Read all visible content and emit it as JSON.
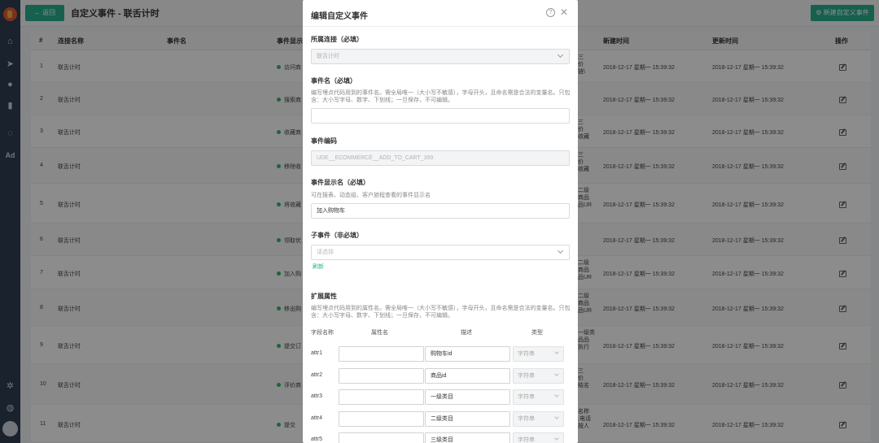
{
  "header": {
    "back_label": "← 返回",
    "title": "自定义事件 - 联舌计时",
    "new_label": "⚙ 新建自定义事件"
  },
  "table": {
    "columns": [
      "#",
      "连接名称",
      "事件名",
      "事件显示",
      "新建时间",
      "更新时间",
      "操作"
    ],
    "rows": [
      {
        "num": "1",
        "conn": "联舌计时",
        "disp": "访问商",
        "created": "2018-12-17 星期一 15:39:32",
        "updated": "2018-12-17 星期一 15:39:32"
      },
      {
        "num": "2",
        "conn": "联舌计时",
        "disp": "搜索商",
        "created": "2018-12-17 星期一 15:39:32",
        "updated": "2018-12-17 星期一 15:39:32"
      },
      {
        "num": "3",
        "conn": "联舌计时",
        "disp": "收藏商",
        "created": "2018-12-17 星期一 15:39:32",
        "updated": "2018-12-17 星期一 15:39:32"
      },
      {
        "num": "4",
        "conn": "联舌计时",
        "disp": "移除收",
        "created": "2018-12-17 星期一 15:39:32",
        "updated": "2018-12-17 星期一 15:39:32"
      },
      {
        "num": "5",
        "conn": "联舌计时",
        "disp": "将收藏",
        "created": "2018-12-17 星期一 15:39:32",
        "updated": "2018-12-17 星期一 15:39:32"
      },
      {
        "num": "6",
        "conn": "联舌计时",
        "disp": "领取优",
        "created": "2018-12-17 星期一 15:39:32",
        "updated": "2018-12-17 星期一 15:39:32"
      },
      {
        "num": "7",
        "conn": "联舌计时",
        "disp": "加入购",
        "created": "2018-12-17 星期一 15:39:32",
        "updated": "2018-12-17 星期一 15:39:32"
      },
      {
        "num": "8",
        "conn": "联舌计时",
        "disp": "移出购",
        "created": "2018-12-17 星期一 15:39:32",
        "updated": "2018-12-17 星期一 15:39:32"
      },
      {
        "num": "9",
        "conn": "联舌计时",
        "disp": "提交订",
        "created": "2018-12-17 星期一 15:39:32",
        "updated": "2018-12-17 星期一 15:39:32"
      },
      {
        "num": "10",
        "conn": "联舌计时",
        "disp": "评价商",
        "created": "2018-12-17 星期一 15:39:32",
        "updated": "2018-12-17 星期一 15:39:32"
      },
      {
        "num": "11",
        "conn": "联舌计时",
        "disp": "提交",
        "created": "2018-12-17 星期一 15:39:32",
        "updated": "2018-12-17 星期一 15:39:32"
      }
    ],
    "fragments": [
      {
        "text": "三\n价\n链\\",
        "row": 0
      },
      {
        "text": "三\n价\n收藏",
        "row": 2
      },
      {
        "text": "三\n价\n收藏",
        "row": 3
      },
      {
        "text": "二级\n商品\n品UR",
        "row": 4
      },
      {
        "text": "二级\n商品\n品UR",
        "row": 6
      },
      {
        "text": "二级\n商品\n品UR",
        "row": 7
      },
      {
        "text": "一级类\n品品\n执行",
        "row": 8
      },
      {
        "text": "三\n价\n结名",
        "row": 9
      },
      {
        "text": "名称\n,电话\n按人",
        "row": 10
      }
    ]
  },
  "modal": {
    "title": "编辑自定义事件",
    "help_glyph": "?",
    "close_glyph": "✕",
    "connection": {
      "label": "所属连接（必填）",
      "value": "联舌计时"
    },
    "event_name": {
      "label": "事件名（必填）",
      "hint": "编写埋点代码用到的事件名。需全局唯一（大小写不敏感），字母开头，且命名需是合法的变量名。只包含：大小写字母、数字、下划线；一旦保存，不可编辑。",
      "value": ""
    },
    "event_code": {
      "label": "事件编码",
      "value": "UDE__ECOMMERCE__ADD_TO_CART_399"
    },
    "display_name": {
      "label": "事件显示名（必填）",
      "hint": "可在报表、动态组、客户旅程查看的事件显示名",
      "value": "加入购物车"
    },
    "sub_event": {
      "label": "子事件（非必填）",
      "placeholder": "请选择",
      "refresh": "刷新"
    },
    "ext": {
      "label": "扩展属性",
      "hint": "编写埋点代码用到的属性名。需全局唯一（大小写不敏感），字母开头，且命名需是合法的变量名。只包含：大小写字母、数字、下划线；一旦保存，不可编辑。",
      "columns": [
        "字段名称",
        "属性名",
        "描述",
        "类型"
      ],
      "rows": [
        {
          "field": "attr1",
          "prop": "",
          "desc": "购物车id",
          "type": "字符串"
        },
        {
          "field": "attr2",
          "prop": "",
          "desc": "商品id",
          "type": "字符串"
        },
        {
          "field": "attr3",
          "prop": "",
          "desc": "一级类目",
          "type": "字符串"
        },
        {
          "field": "attr4",
          "prop": "",
          "desc": "二级类目",
          "type": "字符串"
        },
        {
          "field": "attr5",
          "prop": "",
          "desc": "三级类目",
          "type": "字符串"
        }
      ]
    }
  }
}
